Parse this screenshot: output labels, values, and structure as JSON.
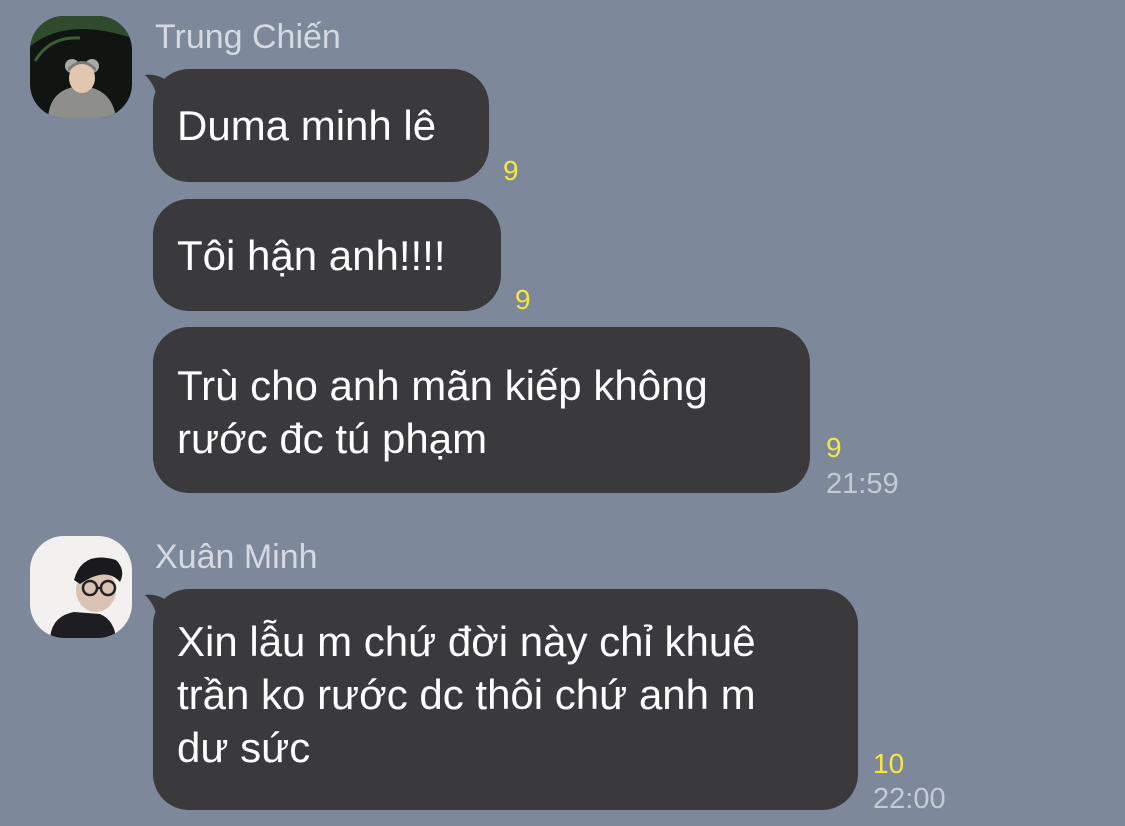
{
  "colors": {
    "background": "#7e889b",
    "bubble": "#3a3a3d",
    "message_text": "#ffffff",
    "sender_name": "#d4d9e2",
    "read_count": "#f5e642",
    "timestamp": "#c5cad3"
  },
  "messages": [
    {
      "sender": "Trung Chiến",
      "avatar_icon": "user-avatar-icon",
      "bubbles": [
        {
          "lines": [
            "Duma minh lê"
          ],
          "read_count": "9",
          "time": ""
        },
        {
          "lines": [
            "Tôi hận anh!!!!"
          ],
          "read_count": "9",
          "time": ""
        },
        {
          "lines": [
            "Trù cho anh mãn kiếp không",
            "rước đc tú phạm"
          ],
          "read_count": "9",
          "time": "21:59"
        }
      ]
    },
    {
      "sender": "Xuân Minh",
      "avatar_icon": "user-avatar-icon",
      "bubbles": [
        {
          "lines": [
            "Xin lẫu m chứ đời này chỉ khuê",
            "trần ko rước dc thôi chứ anh m",
            "dư sức"
          ],
          "read_count": "10",
          "time": "22:00"
        }
      ]
    }
  ]
}
